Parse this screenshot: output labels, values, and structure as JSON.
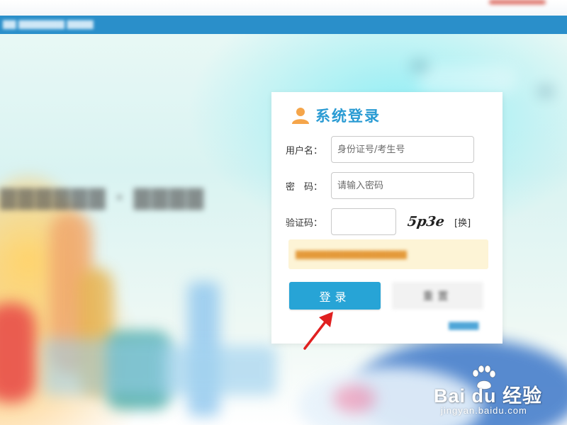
{
  "header": {
    "title": "系统登录"
  },
  "form": {
    "username": {
      "label": "用户名：",
      "value": "",
      "placeholder": "身份证号/考生号"
    },
    "password": {
      "label": "密　码：",
      "value": "",
      "placeholder": "请输入密码"
    },
    "captcha": {
      "label": "验证码：",
      "value": "",
      "image_text": "5p3e",
      "refresh_label": "[换]"
    }
  },
  "actions": {
    "login_label": "登录",
    "reset_label": "重置"
  },
  "colors": {
    "accent": "#27a4d6",
    "title": "#2a9bd3",
    "icon": "#f5a54a",
    "top_bar": "#2a8fca",
    "notice_bg": "#fdf4d6",
    "arrow": "#e02020"
  },
  "icons": {
    "title_icon": "user-icon",
    "annotation": "red-arrow-icon"
  },
  "watermark": {
    "main": "Bai du 经验",
    "sub": "jingyan.baidu.com"
  }
}
